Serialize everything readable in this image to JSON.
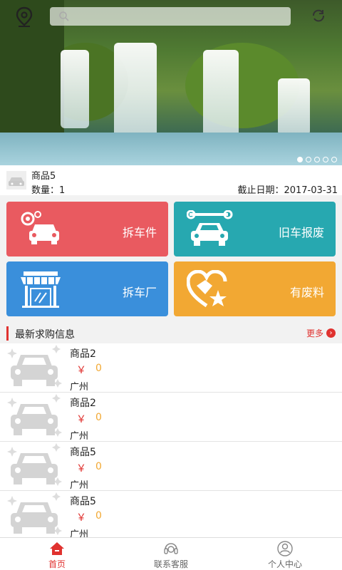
{
  "header": {
    "location_icon": "location-pin-icon",
    "search_icon": "search-icon",
    "search_placeholder": "",
    "refresh_icon": "refresh-icon",
    "carousel": {
      "slides": 5,
      "active": 1
    }
  },
  "notice": {
    "name": "商品5",
    "quantity": "数量：1",
    "deadline": "截止日期：2017-03-31"
  },
  "categories": [
    {
      "label": "拆车件",
      "icon": "car-parts-icon",
      "color": "#e95a60"
    },
    {
      "label": "旧车报废",
      "icon": "car-wrench-icon",
      "color": "#27a8b0"
    },
    {
      "label": "拆车厂",
      "icon": "shop-icon",
      "color": "#3a8fdb"
    },
    {
      "label": "有废料",
      "icon": "heart-handshake-icon",
      "color": "#f2a833"
    }
  ],
  "section": {
    "title": "最新求购信息",
    "more": "更多"
  },
  "listings": [
    {
      "name": "商品2",
      "currency": "￥",
      "price": "0",
      "city": "广州"
    },
    {
      "name": "商品2",
      "currency": "￥",
      "price": "0",
      "city": "广州"
    },
    {
      "name": "商品5",
      "currency": "￥",
      "price": "0",
      "city": "广州"
    },
    {
      "name": "商品5",
      "currency": "￥",
      "price": "0",
      "city": "广州"
    }
  ],
  "tabs": [
    {
      "label": "首页",
      "icon": "home-icon",
      "active": true
    },
    {
      "label": "联系客服",
      "icon": "headset-icon",
      "active": false
    },
    {
      "label": "个人中心",
      "icon": "user-icon",
      "active": false
    }
  ],
  "colors": {
    "accent": "#e0322f",
    "price": "#f2a833"
  }
}
